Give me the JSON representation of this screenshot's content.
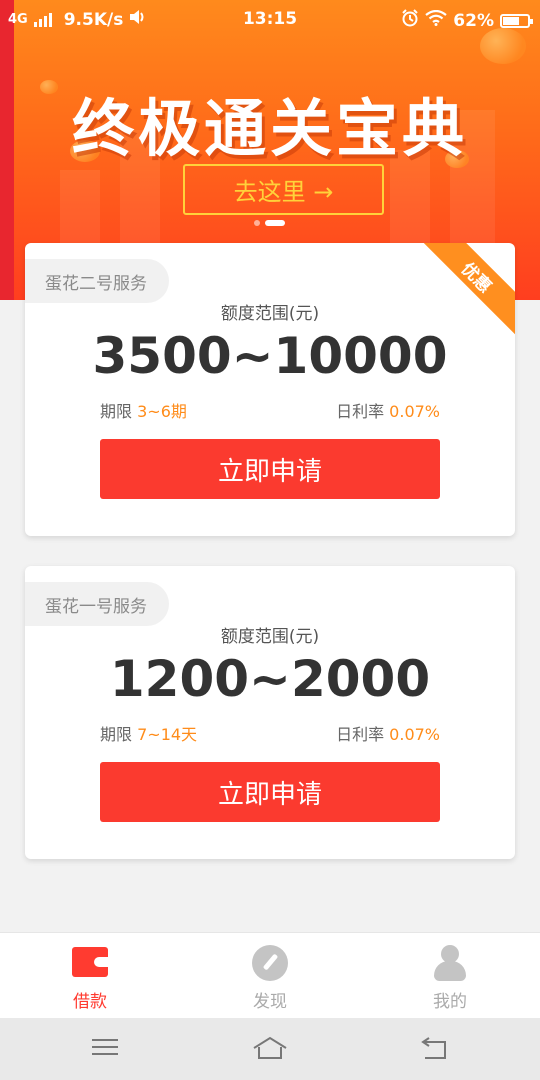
{
  "status_bar": {
    "network": "4G",
    "speed": "9.5K/s",
    "time": "13:15",
    "battery": "62%"
  },
  "banner": {
    "title": "终极通关宝典",
    "button_label": "去这里 →",
    "pager": {
      "count": 2,
      "active_index": 1
    }
  },
  "cards": [
    {
      "tag": "蛋花二号服务",
      "badge": "优惠",
      "range_label": "额度范围(元)",
      "range_value": "3500~10000",
      "term_label": "期限",
      "term_value": "3~6期",
      "rate_label": "日利率",
      "rate_value": "0.07%",
      "apply_label": "立即申请"
    },
    {
      "tag": "蛋花一号服务",
      "range_label": "额度范围(元)",
      "range_value": "1200~2000",
      "term_label": "期限",
      "term_value": "7~14天",
      "rate_label": "日利率",
      "rate_value": "0.07%",
      "apply_label": "立即申请"
    }
  ],
  "tab_bar": {
    "tabs": [
      {
        "label": "借款",
        "icon": "wallet-icon",
        "active": true
      },
      {
        "label": "发现",
        "icon": "compass-icon",
        "active": false
      },
      {
        "label": "我的",
        "icon": "person-icon",
        "active": false
      }
    ]
  },
  "colors": {
    "accent": "#fb3a2f",
    "highlight": "#ff8c1a",
    "banner_gradient_top": "#ff8a1c",
    "banner_gradient_bottom": "#ff3e1f",
    "button_outline": "#ffd23a"
  }
}
